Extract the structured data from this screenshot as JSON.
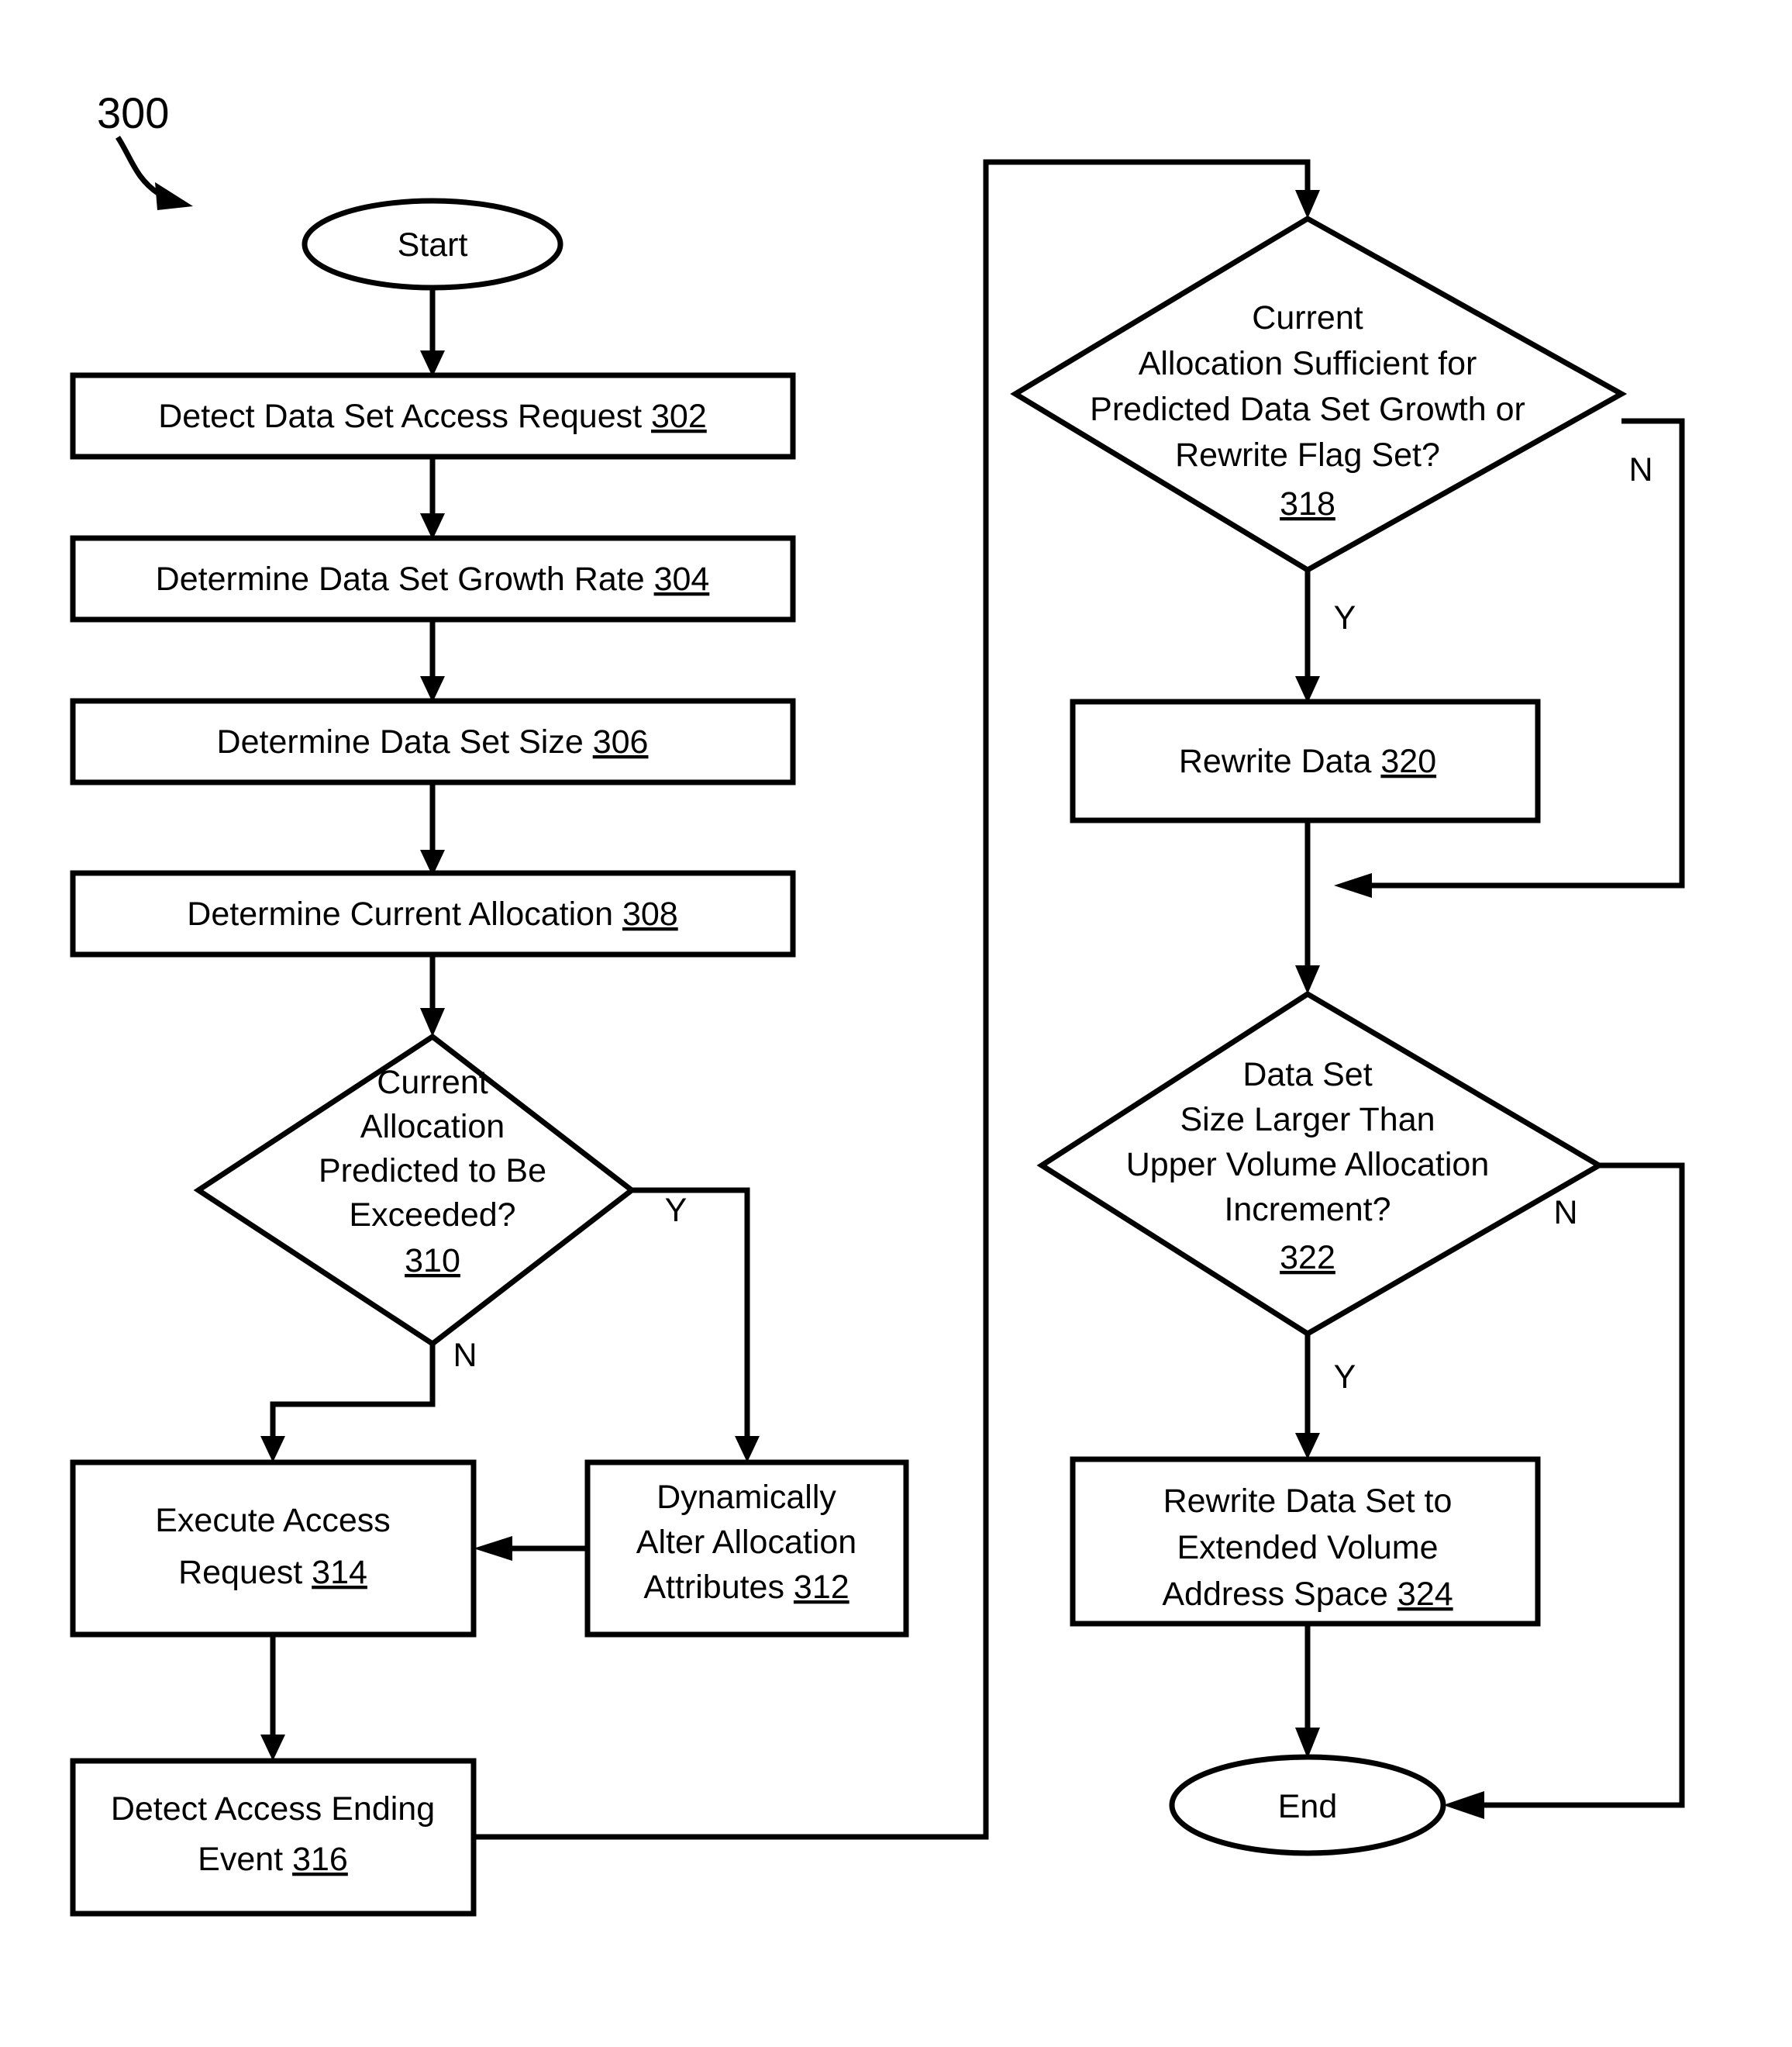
{
  "figure": {
    "number": "300"
  },
  "nodes": {
    "start": {
      "label": "Start"
    },
    "n302": {
      "text": "Detect Data Set Access Request ",
      "ref": "302"
    },
    "n304": {
      "text": "Determine  Data Set Growth Rate ",
      "ref": "304"
    },
    "n306": {
      "text": "Determine Data Set Size ",
      "ref": "306"
    },
    "n308": {
      "text": "Determine Current Allocation ",
      "ref": "308"
    },
    "n310": {
      "line1": "Current",
      "line2": "Allocation",
      "line3": "Predicted to Be",
      "line4": "Exceeded?",
      "ref": "310"
    },
    "n312": {
      "line1": "Dynamically",
      "line2": "Alter Allocation",
      "line3": "Attributes ",
      "ref": "312"
    },
    "n314": {
      "line1": "Execute Access",
      "line2": "Request ",
      "ref": "314"
    },
    "n316": {
      "line1": "Detect Access Ending",
      "line2": "Event ",
      "ref": "316"
    },
    "n318": {
      "line1": "Current",
      "line2": "Allocation Sufficient for",
      "line3": "Predicted Data Set Growth or",
      "line4": "Rewrite Flag Set?",
      "ref": "318"
    },
    "n320": {
      "text": "Rewrite Data ",
      "ref": "320"
    },
    "n322": {
      "line1": "Data Set",
      "line2": "Size Larger Than",
      "line3": "Upper Volume Allocation",
      "line4": "Increment?",
      "ref": "322"
    },
    "n324": {
      "line1": "Rewrite Data Set to",
      "line2": "Extended Volume",
      "line3": "Address Space ",
      "ref": "324"
    },
    "end": {
      "label": "End"
    }
  },
  "branches": {
    "b310_yes": "Y",
    "b310_no": "N",
    "b318_no": "N",
    "b318_yes": "Y",
    "b322_no": "N",
    "b322_yes": "Y"
  },
  "colors": {
    "stroke": "#000000",
    "fill": "#ffffff",
    "text": "#000000"
  }
}
